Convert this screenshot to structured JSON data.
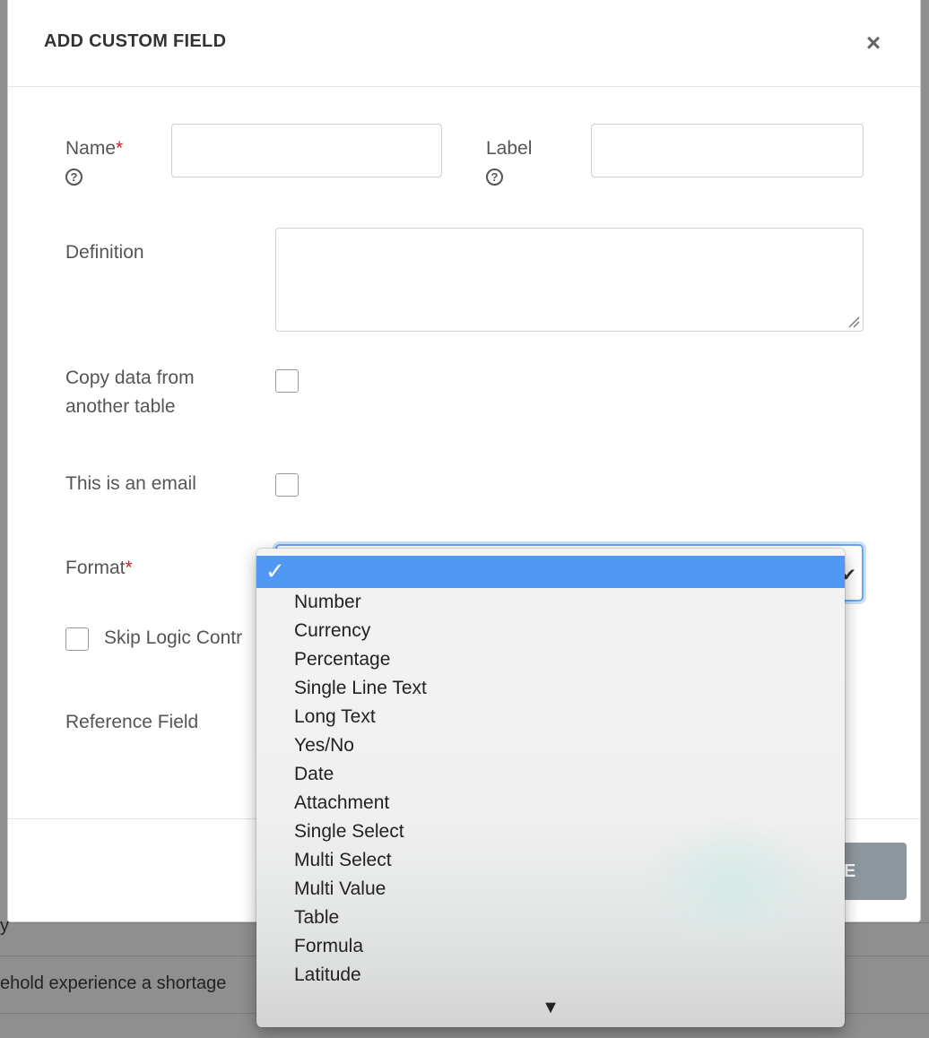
{
  "background": {
    "snippet_a": "y",
    "snippet_b": "ehold experience a shortage"
  },
  "modal": {
    "title": "ADD CUSTOM FIELD",
    "close_icon": "×",
    "fields": {
      "name_label": "Name",
      "name_value": "",
      "label_label": "Label",
      "label_value": "",
      "definition_label": "Definition",
      "definition_value": "",
      "copy_label_line1": "Copy data from",
      "copy_label_line2": "another table",
      "email_label": "This is an email",
      "format_label": "Format",
      "skip_logic_label": "Skip Logic Contr",
      "reference_label": "Reference Field",
      "required_mark": "*",
      "help_glyph": "?"
    },
    "footer": {
      "close_button": "SE"
    }
  },
  "dropdown": {
    "selected_check": "✓",
    "selected_value": "",
    "options": [
      "Number",
      "Currency",
      "Percentage",
      "Single Line Text",
      "Long Text",
      "Yes/No",
      "Date",
      "Attachment",
      "Single Select",
      "Multi Select",
      "Multi Value",
      "Table",
      "Formula",
      "Latitude"
    ],
    "more_indicator": "▼"
  },
  "colors": {
    "required": "#c0222b",
    "selected_highlight": "#4f99f4",
    "focus_border": "#6aa6f0",
    "footer_button": "#8e969e"
  }
}
